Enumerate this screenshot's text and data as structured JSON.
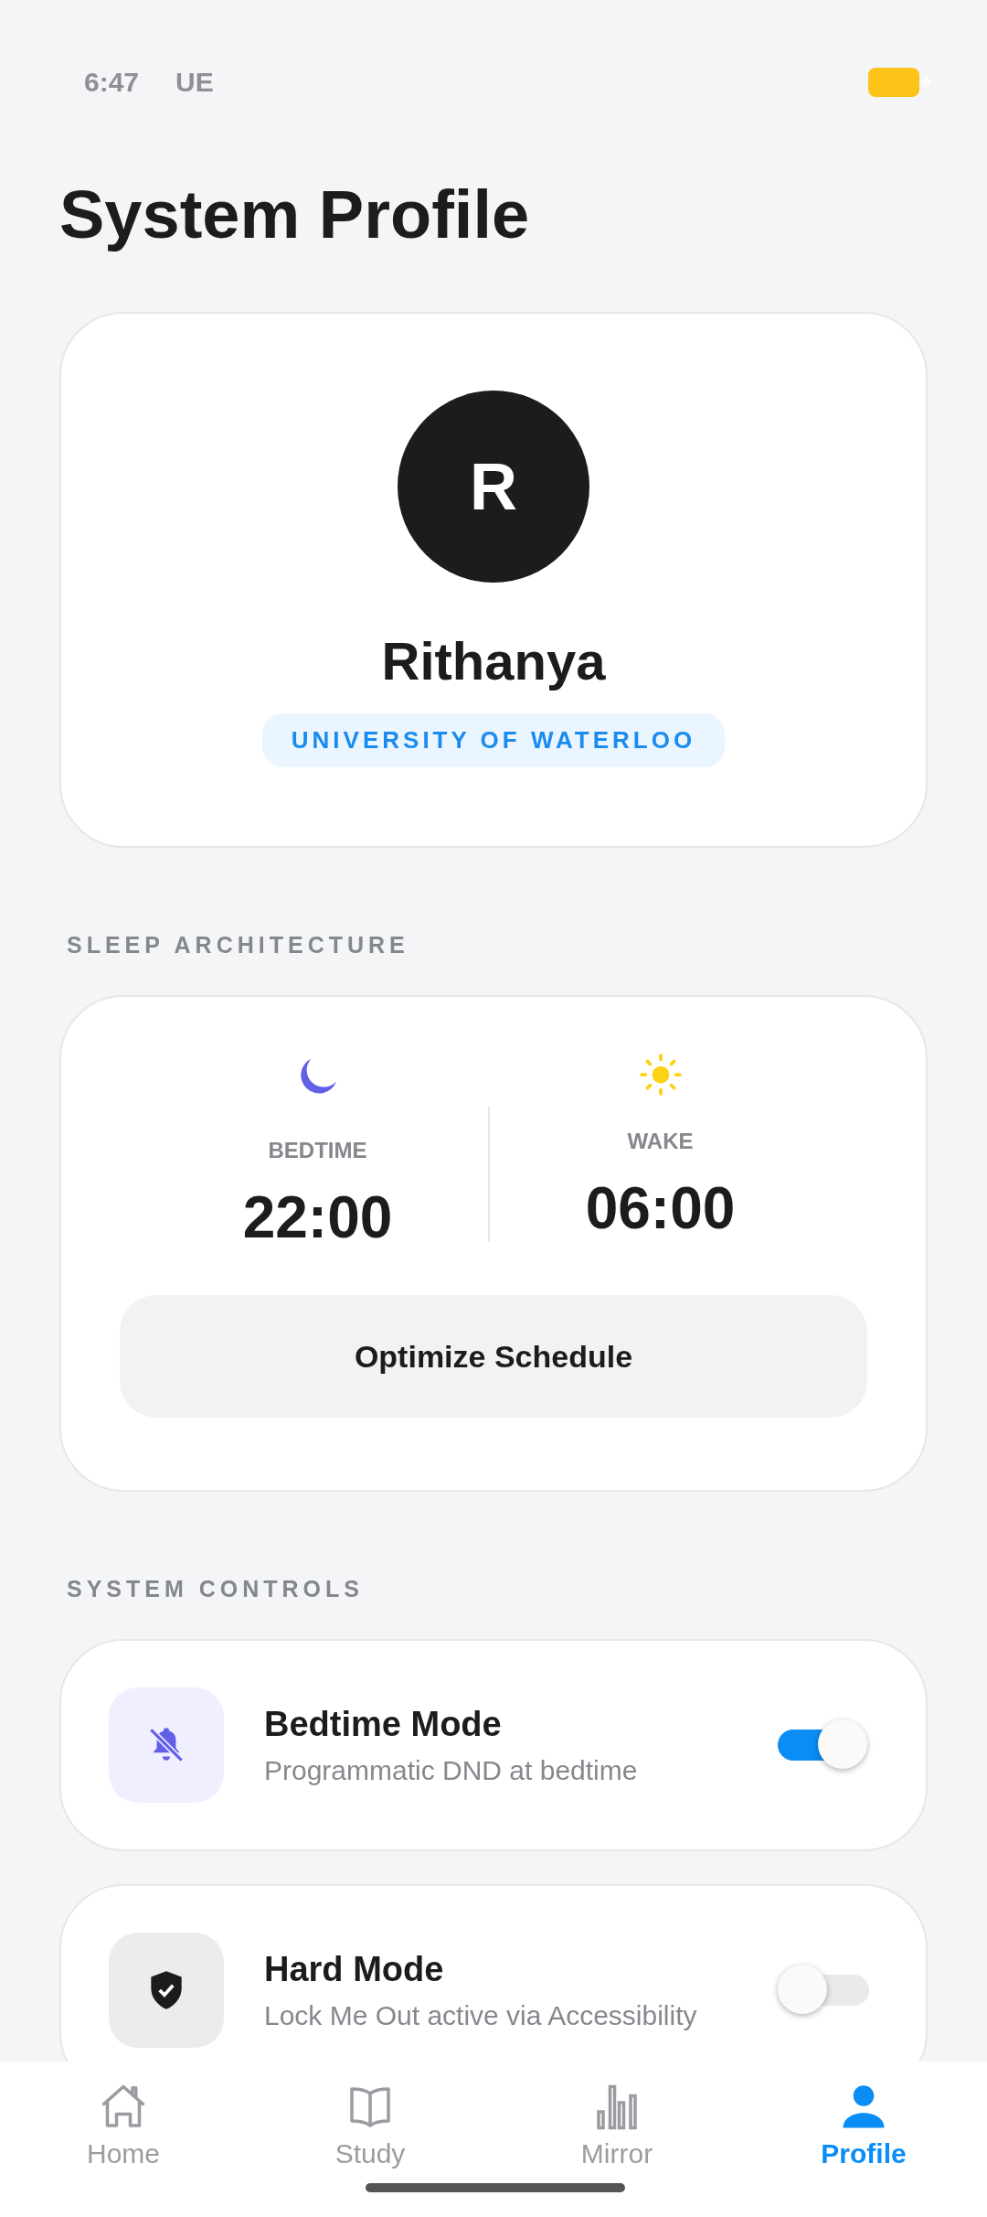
{
  "status_bar": {
    "time": "6:47",
    "carrier": "UE"
  },
  "title": "System Profile",
  "profile": {
    "initial": "R",
    "name": "Rithanya",
    "school": "UNIVERSITY OF WATERLOO"
  },
  "sleep": {
    "heading": "SLEEP ARCHITECTURE",
    "items": [
      {
        "kind": "moon",
        "label": "BEDTIME",
        "time": "22:00"
      },
      {
        "kind": "sun",
        "label": "WAKE",
        "time": "06:00"
      }
    ],
    "button": "Optimize Schedule"
  },
  "controls": {
    "heading": "SYSTEM CONTROLS",
    "items": [
      {
        "kind": "bell",
        "title": "Bedtime Mode",
        "subtitle": "Programmatic DND at bedtime",
        "on": true
      },
      {
        "kind": "shield",
        "title": "Hard Mode",
        "subtitle": "Lock Me Out active via Accessibility",
        "on": false
      }
    ]
  },
  "nav": [
    {
      "kind": "home",
      "label": "Home",
      "selected": false
    },
    {
      "kind": "book",
      "label": "Study",
      "selected": false
    },
    {
      "kind": "bars",
      "label": "Mirror",
      "selected": false
    },
    {
      "kind": "person",
      "label": "Profile",
      "selected": true
    }
  ]
}
